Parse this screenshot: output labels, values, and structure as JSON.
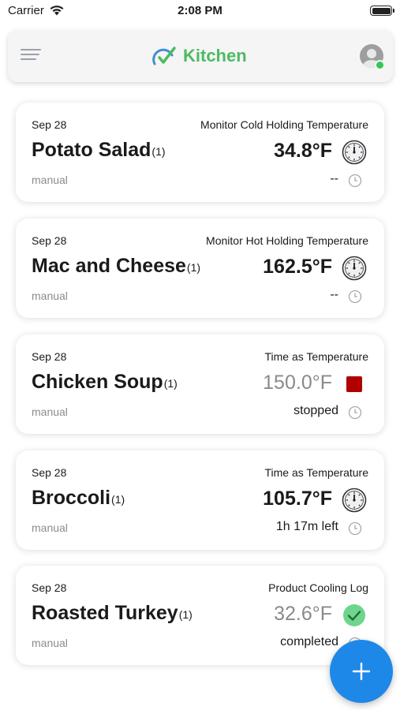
{
  "status_bar": {
    "carrier": "Carrier",
    "time": "2:08 PM"
  },
  "header": {
    "title": "Kitchen",
    "brand_color": "#4cbb62"
  },
  "cards": [
    {
      "date": "Sep 28",
      "type": "Monitor Cold Holding Temperature",
      "name": "Potato Salad",
      "count": "(1)",
      "temp": "34.8°F",
      "source": "manual",
      "status": "--",
      "icon": "thermometer-dial-icon",
      "state": "active"
    },
    {
      "date": "Sep 28",
      "type": "Monitor Hot Holding Temperature",
      "name": "Mac and Cheese",
      "count": "(1)",
      "temp": "162.5°F",
      "source": "manual",
      "status": "--",
      "icon": "thermometer-dial-icon",
      "state": "active"
    },
    {
      "date": "Sep 28",
      "type": "Time as Temperature",
      "name": "Chicken Soup",
      "count": "(1)",
      "temp": "150.0°F",
      "source": "manual",
      "status": "stopped",
      "icon": "stop-icon",
      "state": "stopped"
    },
    {
      "date": "Sep 28",
      "type": "Time as Temperature",
      "name": "Broccoli",
      "count": "(1)",
      "temp": "105.7°F",
      "source": "manual",
      "status": "1h 17m left",
      "icon": "thermometer-dial-icon",
      "state": "active"
    },
    {
      "date": "Sep 28",
      "type": "Product Cooling Log",
      "name": "Roasted Turkey",
      "count": "(1)",
      "temp": "32.6°F",
      "source": "manual",
      "status": "completed",
      "icon": "check-circle-icon",
      "state": "completed"
    }
  ],
  "colors": {
    "fab": "#1e88e8",
    "stop": "#b00000",
    "check": "#6dd58c"
  }
}
